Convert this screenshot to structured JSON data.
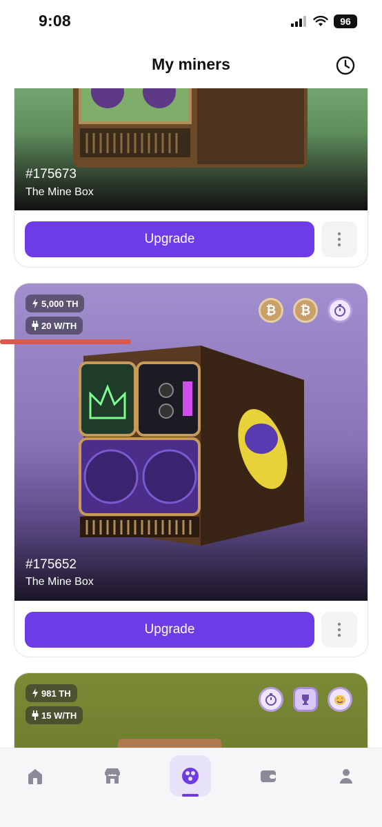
{
  "status_bar": {
    "time": "9:08",
    "battery": "96"
  },
  "header": {
    "title": "My miners"
  },
  "miners": [
    {
      "id": "#175673",
      "name": "The Mine Box",
      "upgrade_label": "Upgrade"
    },
    {
      "id": "#175652",
      "name": "The Mine Box",
      "upgrade_label": "Upgrade",
      "hashrate": "5,000 TH",
      "efficiency": "20 W/TH"
    },
    {
      "hashrate": "981 TH",
      "efficiency": "15 W/TH"
    }
  ],
  "colors": {
    "accent": "#6d3ce6",
    "card2_bg": "#8a74b8",
    "card3_bg": "#6f7f2d"
  },
  "nav": {
    "items": [
      "home-icon",
      "shop-icon",
      "miners-icon",
      "wallet-icon",
      "profile-icon"
    ],
    "active": "miners-icon"
  }
}
